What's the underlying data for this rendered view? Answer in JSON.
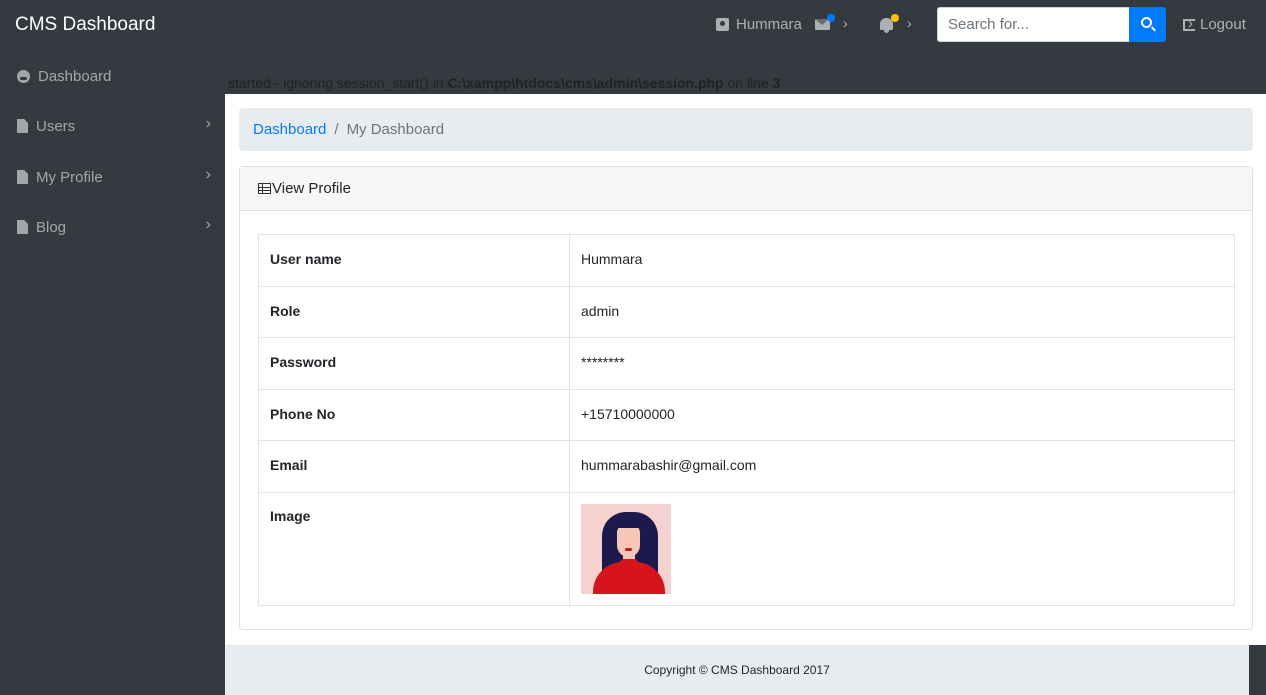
{
  "navbar": {
    "brand": "CMS Dashboard",
    "user_name": "Hummara",
    "search_placeholder": "Search for...",
    "logout_label": "Logout",
    "message_indicator_color": "#007bff",
    "notification_indicator_color": "#ffc107"
  },
  "sidebar": {
    "items": [
      {
        "label": "Dashboard",
        "icon": "dashboard-icon"
      },
      {
        "label": "Users",
        "icon": "file-icon"
      },
      {
        "label": "My Profile",
        "icon": "file-icon"
      },
      {
        "label": "Blog",
        "icon": "file-icon"
      }
    ]
  },
  "warning": {
    "prefix": "started - ignoring session_start() in ",
    "path": "C:\\xampp\\htdocs\\cms\\admin\\session.php",
    "middle": " on line ",
    "line": "3"
  },
  "breadcrumb": {
    "link": "Dashboard",
    "separator": "/",
    "current": "My Dashboard"
  },
  "card": {
    "title": "View Profile",
    "rows": [
      {
        "key": "User name",
        "value": "Hummara"
      },
      {
        "key": "Role",
        "value": "admin"
      },
      {
        "key": "Password",
        "value": "********"
      },
      {
        "key": "Phone No",
        "value": "+15710000000"
      },
      {
        "key": "Email",
        "value": "hummarabashir@gmail.com"
      },
      {
        "key": "Image",
        "value": ""
      }
    ]
  },
  "footer": {
    "text": "Copyright © CMS Dashboard 2017"
  },
  "colors": {
    "accent": "#007bff",
    "sidebar_bg": "#343a40"
  }
}
